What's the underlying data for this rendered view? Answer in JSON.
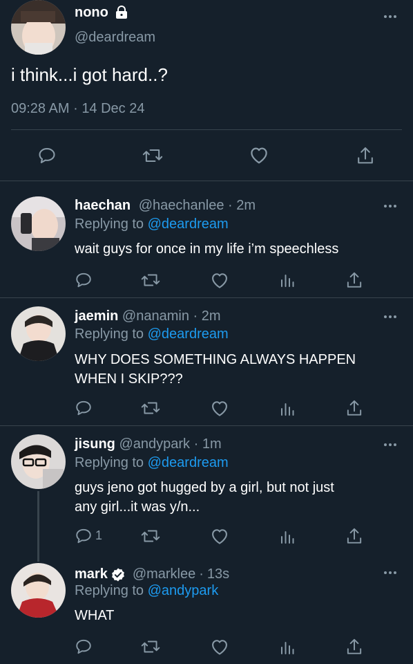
{
  "main_tweet": {
    "name": "nono",
    "handle": "@deardream",
    "text": "i think...i got hard..?",
    "time": "09:28 AM",
    "date": "14 Dec 24",
    "separator": "·"
  },
  "replies": [
    {
      "name": "haechan",
      "handle": "@haechanlee",
      "sep": "·",
      "age": "2m",
      "replying_prefix": "Replying to",
      "replying_to": "@deardream",
      "text": "wait guys for once in my life i’m speechless"
    },
    {
      "name": "jaemin",
      "handle": "@nanamin",
      "sep": "·",
      "age": "2m",
      "replying_prefix": "Replying to",
      "replying_to": "@deardream",
      "text_line1": "WHY DOES SOMETHING ALWAYS HAPPEN",
      "text_line2": "WHEN I SKIP???"
    },
    {
      "name": "jisung",
      "handle": "@andypark",
      "sep": "·",
      "age": "1m",
      "replying_prefix": "Replying to",
      "replying_to": "@deardream",
      "text_line1": "guys jeno got hugged by a girl, but not just",
      "text_line2": "any girl...it was y/n...",
      "reply_count": "1"
    },
    {
      "name": "mark",
      "handle": "@marklee",
      "sep": "·",
      "age": "13s",
      "replying_prefix": "Replying to",
      "replying_to": "@andypark",
      "text": "WHAT"
    }
  ],
  "icons": {
    "lock": "lock-icon",
    "verified": "verified-badge-icon",
    "reply": "reply-icon",
    "retweet": "retweet-icon",
    "like": "like-icon",
    "share": "share-icon",
    "analytics": "analytics-icon",
    "more": "more-icon"
  },
  "colors": {
    "background": "#15202b",
    "divider": "#38444d",
    "muted": "#8899a6",
    "link": "#1d9bf0",
    "text": "#ffffff"
  }
}
